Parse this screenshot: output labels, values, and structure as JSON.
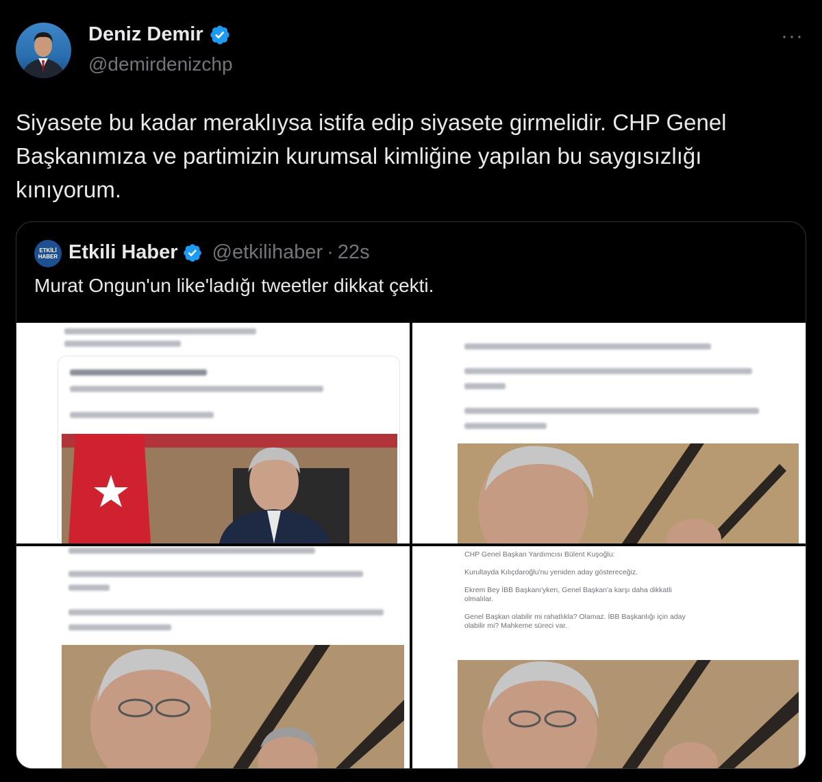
{
  "author": {
    "name": "Deniz Demir",
    "handle": "@demirdenizchp",
    "verified": true
  },
  "more_label": "···",
  "tweet": {
    "text": "Siyasete bu kadar meraklıysa istifa edip siyasete girmelidir. CHP Genel\nBaşkanımıza ve partimizin kurumsal kimliğine yapılan bu saygısızlığı\nkınıyorum."
  },
  "quote": {
    "avatar_text": "ETKİLİ HABER",
    "name": "Etkili Haber",
    "verified": true,
    "handle": "@etkilihaber",
    "separator": "·",
    "time": "22s",
    "text": "Murat Ongun'un like'ladığı tweetler dikkat çekti.",
    "image4_text": "CHP Genel Başkan Yardımcısı Bülent Kuşoğlu:\n\nKurultayda Kılıçdaroğlu'nu yeniden aday göstereceğiz.\n\nEkrem Bey İBB Başkanı'yken, Genel Başkan'a karşı daha dikkatli\nolmalılar.\n\nGenel Başkan olabilir mi rahatlıkla? Olamaz. İBB Başkanlığı için aday\nolabilir mi? Mahkeme süreci var."
  },
  "colors": {
    "background": "#000000",
    "text": "#e7e9ea",
    "muted": "#71767b",
    "verified": "#1d9bf0",
    "border": "#2f3336"
  }
}
